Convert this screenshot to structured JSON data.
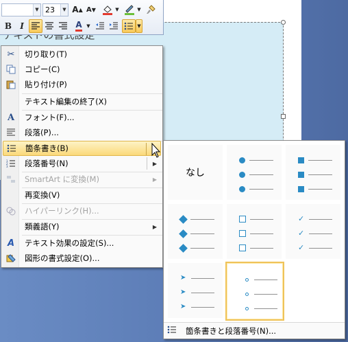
{
  "slide": {
    "title_fragment": "定",
    "body_fragment": "テキストの書式設定"
  },
  "mini_toolbar": {
    "font_name": "",
    "font_size": "23",
    "grow_font": "A",
    "shrink_font": "A",
    "bold": "B",
    "italic": "I",
    "font_color_letter": "A"
  },
  "menu": {
    "items": [
      {
        "label": "切り取り(T)",
        "icon": "scissors-icon",
        "enabled": true
      },
      {
        "label": "コピー(C)",
        "icon": "copy-icon",
        "enabled": true
      },
      {
        "label": "貼り付け(P)",
        "icon": "paste-icon",
        "enabled": true
      },
      {
        "label": "テキスト編集の終了(X)",
        "icon": "",
        "enabled": true
      },
      {
        "label": "フォント(F)...",
        "icon": "font-icon",
        "enabled": true
      },
      {
        "label": "段落(P)...",
        "icon": "paragraph-icon",
        "enabled": true
      },
      {
        "label": "箇条書き(B)",
        "icon": "bullets-icon",
        "enabled": true,
        "submenu": true,
        "highlighted": true
      },
      {
        "label": "段落番号(N)",
        "icon": "numbering-icon",
        "enabled": true,
        "submenu": true
      },
      {
        "label": "SmartArt に変換(M)",
        "icon": "smartart-icon",
        "enabled": false,
        "submenu": true
      },
      {
        "label": "再変換(V)",
        "icon": "",
        "enabled": true
      },
      {
        "label": "ハイパーリンク(H)...",
        "icon": "hyperlink-icon",
        "enabled": false
      },
      {
        "label": "類義語(Y)",
        "icon": "",
        "enabled": true,
        "submenu": true
      },
      {
        "label": "テキスト効果の設定(S)...",
        "icon": "text-effects-icon",
        "enabled": true
      },
      {
        "label": "図形の書式設定(O)...",
        "icon": "shape-format-icon",
        "enabled": true
      }
    ]
  },
  "gallery": {
    "none_label": "なし",
    "footer_label": "箇条書きと段落番号(N)...",
    "bullet_color": "#2a8bc4",
    "selected_accent": "#efc35a"
  }
}
